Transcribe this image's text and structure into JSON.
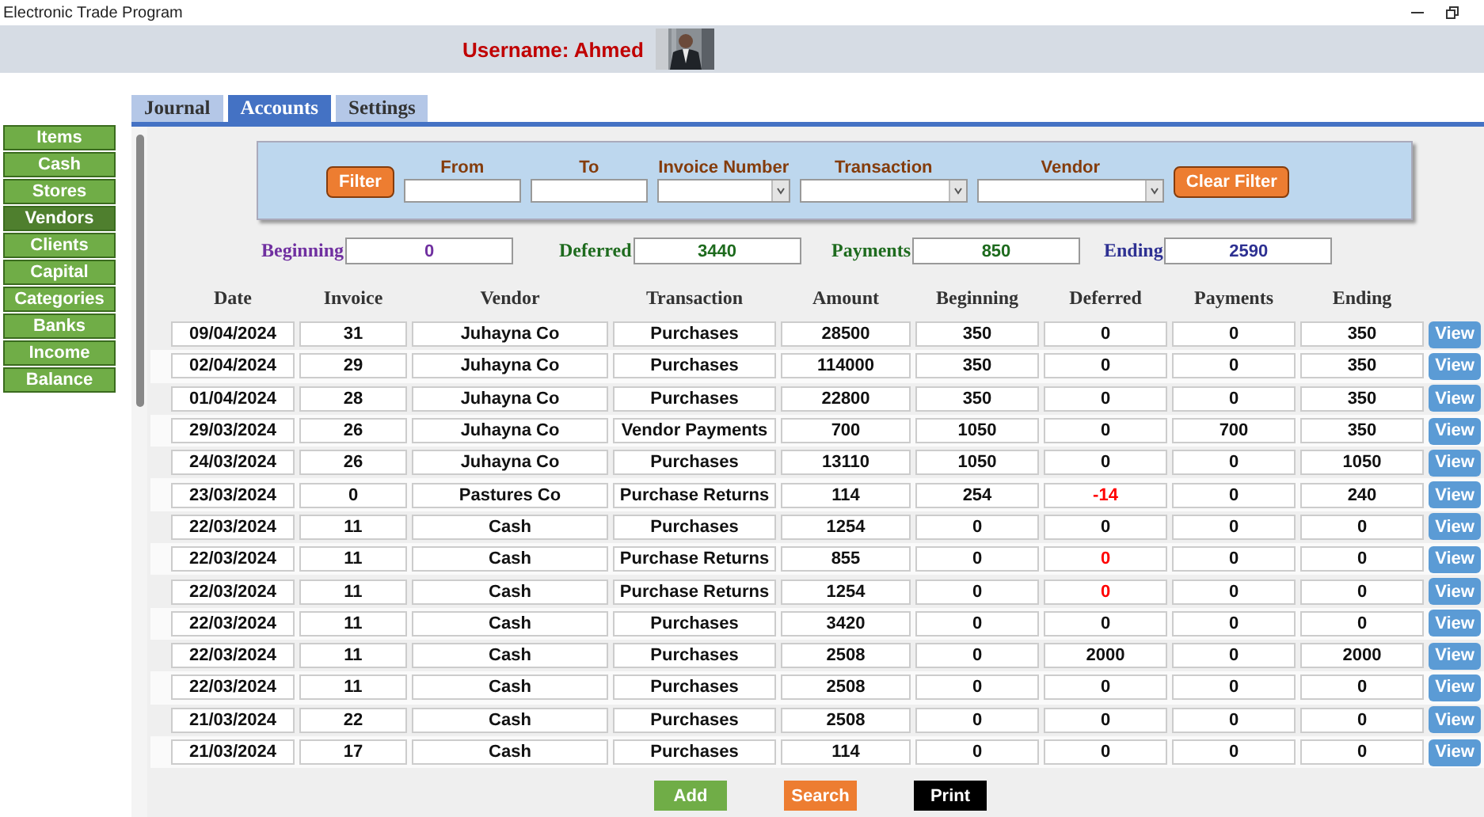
{
  "window": {
    "title": "Electronic Trade Program"
  },
  "header": {
    "username": "Username: Ahmed"
  },
  "sidebar": {
    "items": [
      {
        "label": "Items",
        "selected": false
      },
      {
        "label": "Cash",
        "selected": false
      },
      {
        "label": "Stores",
        "selected": false
      },
      {
        "label": "Vendors",
        "selected": true
      },
      {
        "label": "Clients",
        "selected": false
      },
      {
        "label": "Capital",
        "selected": false
      },
      {
        "label": "Categories",
        "selected": false
      },
      {
        "label": "Banks",
        "selected": false
      },
      {
        "label": "Income",
        "selected": false
      },
      {
        "label": "Balance",
        "selected": false
      }
    ]
  },
  "tabs": [
    {
      "label": "Journal",
      "selected": false
    },
    {
      "label": "Accounts",
      "selected": true
    },
    {
      "label": "Settings",
      "selected": false
    }
  ],
  "filter": {
    "filter_button": "Filter",
    "clear_button": "Clear Filter",
    "fields": [
      {
        "label": "From",
        "kind": "text"
      },
      {
        "label": "To",
        "kind": "text"
      },
      {
        "label": "Invoice Number",
        "kind": "dropdown"
      },
      {
        "label": "Transaction",
        "kind": "dropdown"
      },
      {
        "label": "Vendor",
        "kind": "dropdown"
      }
    ]
  },
  "totals": [
    {
      "label": "Beginning",
      "value": "0",
      "color": "#7030a0"
    },
    {
      "label": "Deferred",
      "value": "3440",
      "color": "#1e6b1e"
    },
    {
      "label": "Payments",
      "value": "850",
      "color": "#1e6b1e"
    },
    {
      "label": "Ending",
      "value": "2590",
      "color": "#2e3192"
    }
  ],
  "table": {
    "columns": [
      "Date",
      "Invoice",
      "Vendor",
      "Transaction",
      "Amount",
      "Beginning",
      "Deferred",
      "Payments",
      "Ending"
    ],
    "rows": [
      {
        "cells": [
          "09/04/2024",
          "31",
          "Juhayna Co",
          "Purchases",
          "28500",
          "350",
          "0",
          "0",
          "350"
        ],
        "deferred_flagged": false,
        "action": "View"
      },
      {
        "cells": [
          "02/04/2024",
          "29",
          "Juhayna Co",
          "Purchases",
          "114000",
          "350",
          "0",
          "0",
          "350"
        ],
        "deferred_flagged": false,
        "action": "View"
      },
      {
        "cells": [
          "01/04/2024",
          "28",
          "Juhayna Co",
          "Purchases",
          "22800",
          "350",
          "0",
          "0",
          "350"
        ],
        "deferred_flagged": false,
        "action": "View"
      },
      {
        "cells": [
          "29/03/2024",
          "26",
          "Juhayna Co",
          "Vendor Payments",
          "700",
          "1050",
          "0",
          "700",
          "350"
        ],
        "deferred_flagged": false,
        "action": "View"
      },
      {
        "cells": [
          "24/03/2024",
          "26",
          "Juhayna Co",
          "Purchases",
          "13110",
          "1050",
          "0",
          "0",
          "1050"
        ],
        "deferred_flagged": false,
        "action": "View"
      },
      {
        "cells": [
          "23/03/2024",
          "0",
          "Pastures Co",
          "Purchase Returns",
          "114",
          "254",
          "-14",
          "0",
          "240"
        ],
        "deferred_flagged": true,
        "action": "View"
      },
      {
        "cells": [
          "22/03/2024",
          "11",
          "Cash",
          "Purchases",
          "1254",
          "0",
          "0",
          "0",
          "0"
        ],
        "deferred_flagged": false,
        "action": "View"
      },
      {
        "cells": [
          "22/03/2024",
          "11",
          "Cash",
          "Purchase Returns",
          "855",
          "0",
          "0",
          "0",
          "0"
        ],
        "deferred_flagged": true,
        "action": "View"
      },
      {
        "cells": [
          "22/03/2024",
          "11",
          "Cash",
          "Purchase Returns",
          "1254",
          "0",
          "0",
          "0",
          "0"
        ],
        "deferred_flagged": true,
        "action": "View"
      },
      {
        "cells": [
          "22/03/2024",
          "11",
          "Cash",
          "Purchases",
          "3420",
          "0",
          "0",
          "0",
          "0"
        ],
        "deferred_flagged": false,
        "action": "View"
      },
      {
        "cells": [
          "22/03/2024",
          "11",
          "Cash",
          "Purchases",
          "2508",
          "0",
          "2000",
          "0",
          "2000"
        ],
        "deferred_flagged": false,
        "action": "View"
      },
      {
        "cells": [
          "22/03/2024",
          "11",
          "Cash",
          "Purchases",
          "2508",
          "0",
          "0",
          "0",
          "0"
        ],
        "deferred_flagged": false,
        "action": "View"
      },
      {
        "cells": [
          "21/03/2024",
          "22",
          "Cash",
          "Purchases",
          "2508",
          "0",
          "0",
          "0",
          "0"
        ],
        "deferred_flagged": false,
        "action": "View"
      },
      {
        "cells": [
          "21/03/2024",
          "17",
          "Cash",
          "Purchases",
          "114",
          "0",
          "0",
          "0",
          "0"
        ],
        "deferred_flagged": false,
        "action": "View"
      }
    ]
  },
  "actions": [
    {
      "label": "Add",
      "kind": "add"
    },
    {
      "label": "Search",
      "kind": "search"
    },
    {
      "label": "Print",
      "kind": "print"
    }
  ]
}
